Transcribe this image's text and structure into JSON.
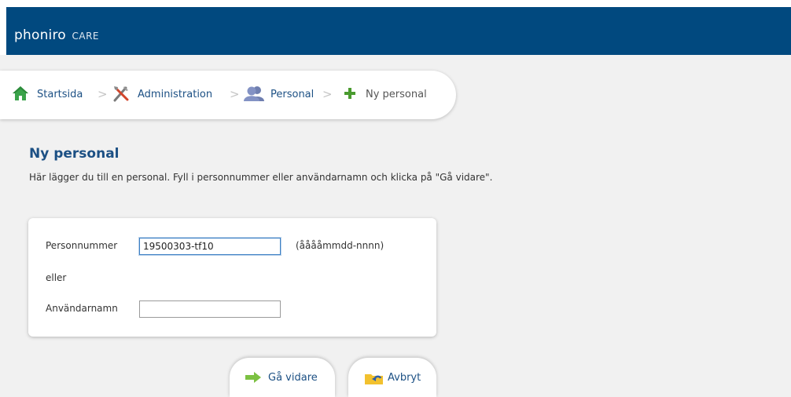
{
  "app": {
    "brand_name": "phoniro",
    "brand_suffix": "CARE"
  },
  "breadcrumb": [
    {
      "label": "Startsida",
      "icon": "home-icon"
    },
    {
      "label": "Administration",
      "icon": "tools-icon"
    },
    {
      "label": "Personal",
      "icon": "users-icon"
    },
    {
      "label": "Ny personal",
      "icon": "plus-icon"
    }
  ],
  "breadcrumb_separator": ">",
  "page": {
    "title": "Ny personal",
    "description": "Här lägger du till en personal. Fyll i personnummer eller användarnamn och klicka på \"Gå vidare\"."
  },
  "form": {
    "personnummer_label": "Personnummer",
    "personnummer_value": "19500303-tf10",
    "personnummer_hint": "(ååååmmdd-nnnn)",
    "or_label": "eller",
    "username_label": "Användarnamn",
    "username_value": ""
  },
  "actions": {
    "next_label": "Gå vidare",
    "cancel_label": "Avbryt"
  },
  "colors": {
    "header": "#01497f",
    "link": "#1c5084",
    "next_arrow": "#7cc142",
    "cancel_icon": "#f2c12e"
  }
}
